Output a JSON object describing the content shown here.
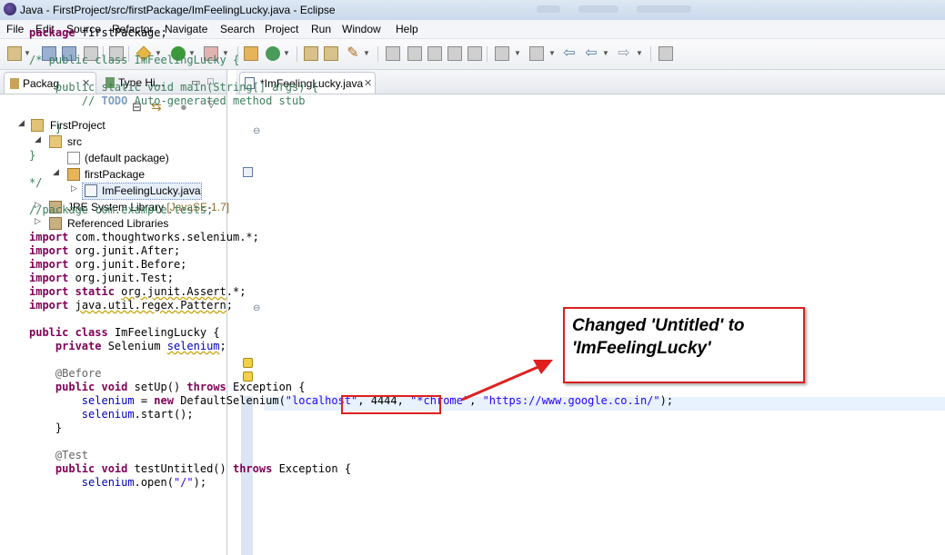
{
  "window": {
    "title": "Java - FirstProject/src/firstPackage/ImFeelingLucky.java - Eclipse"
  },
  "menu": [
    "File",
    "Edit",
    "Source",
    "Refactor",
    "Navigate",
    "Search",
    "Project",
    "Run",
    "Window",
    "Help"
  ],
  "left_panel": {
    "tabs": [
      {
        "label": "Packag...",
        "active": true
      },
      {
        "label": "Type Hi...",
        "active": false
      }
    ],
    "tree": {
      "project": "FirstProject",
      "src": "src",
      "default_package": "(default package)",
      "first_package": "firstPackage",
      "file": "ImFeelingLucky.java",
      "jre": "JRE System Library",
      "jre_version": "[JavaSE-1.7]",
      "ref_libs": "Referenced Libraries"
    }
  },
  "editor": {
    "tab_label": "*ImFeelingLucky.java",
    "code": {
      "l1_kw": "package",
      "l1_rest": " firstPackage;",
      "l2": "/* public class ImFeelingLucky {",
      "l3": "    public static void main(String[] args) {",
      "l4_a": "        // ",
      "l4_todo": "TODO",
      "l4_b": " Auto-generated method stub",
      "l5": "    }",
      "l6": "}",
      "l7": "*/",
      "l8": "//package com.example.tests;",
      "imports": [
        {
          "kw": "import",
          "rest": " com.thoughtworks.selenium.*;"
        },
        {
          "kw": "import",
          "rest": " org.junit.After;"
        },
        {
          "kw": "import",
          "rest": " org.junit.Before;"
        },
        {
          "kw": "import",
          "rest": " org.junit.Test;"
        }
      ],
      "imp5_kw": "import static",
      "imp5_a": " ",
      "imp5_ul": "org.junit.Assert",
      "imp5_b": ".*;",
      "imp6_kw": "import",
      "imp6_a": " ",
      "imp6_ul": "java.util.regex.Pattern",
      "imp6_b": ";",
      "cls_kw": "public class",
      "cls_name": "ImFeelingLucky",
      "cls_brace": " {",
      "fld_kw": "private",
      "fld_type": " Selenium ",
      "fld_name": "selenium",
      "fld_end": ";",
      "ann_before": "@Before",
      "setup_kw1": "public void",
      "setup_mid": " setUp() ",
      "setup_kw2": "throws",
      "setup_end": " Exception {",
      "ds_field": "selenium",
      "ds_eq": " = ",
      "ds_new": "new",
      "ds_cls": " DefaultSelenium(",
      "ds_s1": "\"localhost\"",
      "ds_p": ", 4444, ",
      "ds_s2": "\"*chrome\"",
      "ds_c": ", ",
      "ds_s3": "\"https://www.google.co.in/\"",
      "ds_end": ");",
      "start_field": "selenium",
      "start_rest": ".start();",
      "close": "    }",
      "ann_test": "@Test",
      "test_kw1": "public void",
      "test_mid": " testUntitled() ",
      "test_kw2": "throws",
      "test_end": " Exception {",
      "open_field": "selenium",
      "open_rest": ".open(",
      "open_str": "\"/\"",
      "open_end": ");"
    }
  },
  "callout": {
    "text_line1": "Changed 'Untitled' to",
    "text_line2": "'ImFeelingLucky'"
  },
  "colors": {
    "keyword": "#7f0055",
    "comment": "#3f7f5f",
    "string": "#2a00ff",
    "field": "#0000c0",
    "annotation_border": "#e02020"
  }
}
